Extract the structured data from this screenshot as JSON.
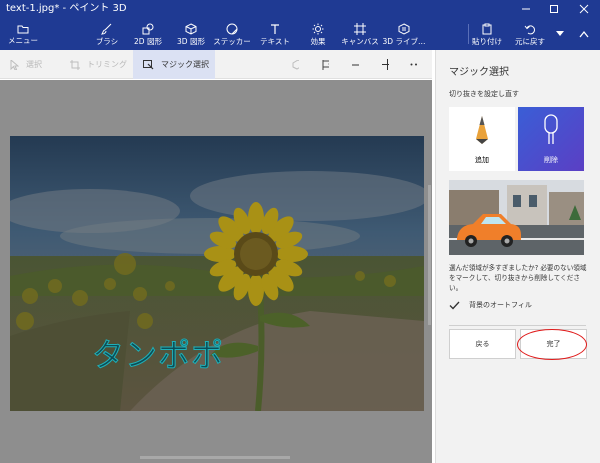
{
  "window": {
    "title": "text-1.jpg* - ペイント 3D"
  },
  "toolbar": {
    "menu_label": "メニュー",
    "tools": [
      {
        "label": "ブラシ",
        "icon": "brush-icon"
      },
      {
        "label": "2D 図形",
        "icon": "shape-2d-icon"
      },
      {
        "label": "3D 図形",
        "icon": "shape-3d-icon"
      },
      {
        "label": "ステッカー",
        "icon": "sticker-icon"
      },
      {
        "label": "テキスト",
        "icon": "text-icon"
      },
      {
        "label": "効果",
        "icon": "effects-icon"
      },
      {
        "label": "キャンバス",
        "icon": "canvas-icon"
      },
      {
        "label": "3D ライブ…",
        "icon": "library-3d-icon"
      }
    ],
    "paste_label": "貼り付け",
    "undo_label": "元に戻す"
  },
  "subbar": {
    "select_label": "選択",
    "crop_label": "トリミング",
    "magic_select_label": "マジック選択"
  },
  "canvas": {
    "photo_text": "タンポポ"
  },
  "panel": {
    "title": "マジック選択",
    "subtitle": "切り抜きを設定し直す",
    "add_label": "追加",
    "remove_label": "削除",
    "description": "選んだ領域が多すぎましたか? 必要のない領域をマークして、切り抜きから削除してください。",
    "autofill_label": "背景のオートフィル",
    "autofill_checked": true,
    "back_label": "戻る",
    "done_label": "完了"
  },
  "colors": {
    "titlebar": "#1f3a93",
    "accent": "#3d4ed1",
    "annotation": "#e01b1b"
  }
}
